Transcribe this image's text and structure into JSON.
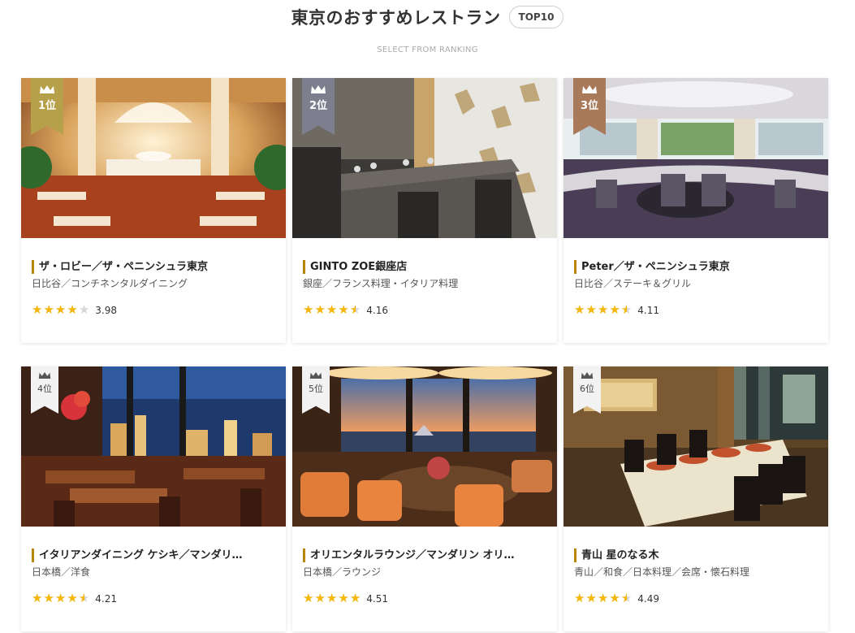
{
  "header": {
    "title": "東京のおすすめレストラン",
    "badge": "TOP10",
    "subtitle": "SELECT FROM RANKING"
  },
  "colors": {
    "gold": "#b7a04a",
    "silver": "#7d7f8e",
    "bronze": "#a87a5a",
    "plain_badge": "#f2f2f2",
    "star": "#f5b70a",
    "accent_bar": "#b8860b"
  },
  "restaurants": [
    {
      "rank_label": "1位",
      "name": "ザ・ロビー／ザ・ペニンシュラ東京",
      "area": "日比谷／コンチネンタルダイニング",
      "rating": 3.98,
      "rating_text": "3.98",
      "stars_shown": 4,
      "badge_style": "gold",
      "photo_icon": "lobby-dining-photo"
    },
    {
      "rank_label": "2位",
      "name": "GINTO ZOE銀座店",
      "area": "銀座／フランス料理・イタリア料理",
      "rating": 4.16,
      "rating_text": "4.16",
      "stars_shown": 4.5,
      "badge_style": "silver",
      "photo_icon": "private-dining-photo"
    },
    {
      "rank_label": "3位",
      "name": "Peter／ザ・ペニンシュラ東京",
      "area": "日比谷／ステーキ＆グリル",
      "rating": 4.11,
      "rating_text": "4.11",
      "stars_shown": 4.5,
      "badge_style": "bronze",
      "photo_icon": "grill-restaurant-photo"
    },
    {
      "rank_label": "4位",
      "name": "イタリアンダイニング ケシキ／マンダリ…",
      "area": "日本橋／洋食",
      "rating": 4.21,
      "rating_text": "4.21",
      "stars_shown": 4.5,
      "badge_style": "plain",
      "photo_icon": "night-view-dining-photo"
    },
    {
      "rank_label": "5位",
      "name": "オリエンタルラウンジ／マンダリン オリ…",
      "area": "日本橋／ラウンジ",
      "rating": 4.51,
      "rating_text": "4.51",
      "stars_shown": 5,
      "badge_style": "plain",
      "photo_icon": "lounge-photo"
    },
    {
      "rank_label": "6位",
      "name": "青山 星のなる木",
      "area": "青山／和食／日本料理／会席・懐石料理",
      "rating": 4.49,
      "rating_text": "4.49",
      "stars_shown": 4.5,
      "badge_style": "plain",
      "photo_icon": "private-room-photo"
    }
  ]
}
